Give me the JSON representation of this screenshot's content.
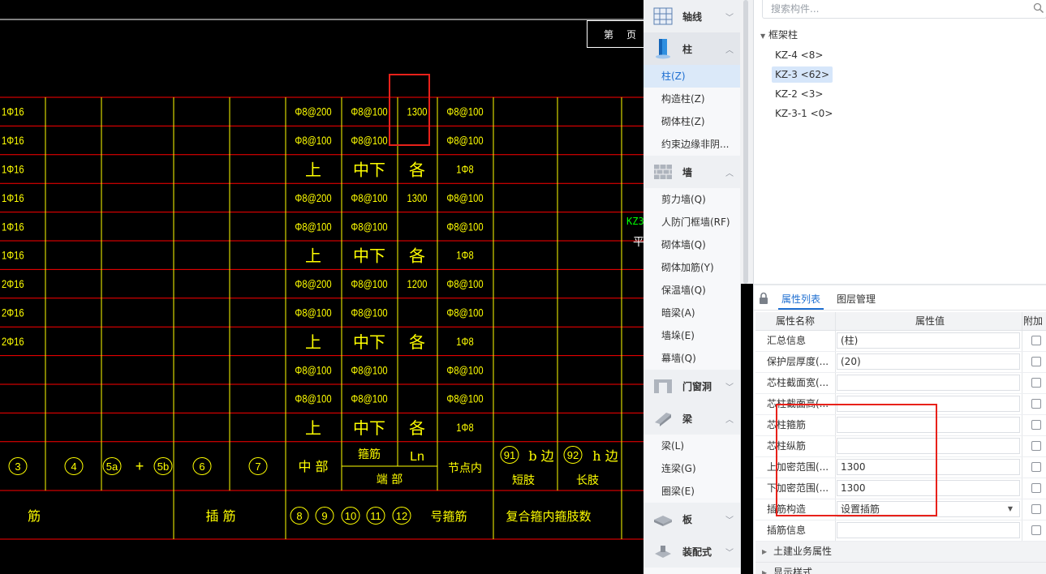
{
  "cad": {
    "title_cells": [
      "第",
      "页"
    ],
    "note_line1": "KZ3",
    "note_line2": "平",
    "rows": [
      [
        "1Φ16",
        "Φ8@200",
        "Φ8@100",
        "1300",
        "Φ8@100"
      ],
      [
        "1Φ16",
        "Φ8@100",
        "Φ8@100",
        "",
        "Φ8@100"
      ],
      [
        "1Φ16",
        "上",
        "中下",
        "各",
        "1Φ8"
      ],
      [
        "1Φ16",
        "Φ8@200",
        "Φ8@100",
        "1300",
        "Φ8@100"
      ],
      [
        "1Φ16",
        "Φ8@100",
        "Φ8@100",
        "",
        "Φ8@100"
      ],
      [
        "1Φ16",
        "上",
        "中下",
        "各",
        "1Φ8"
      ],
      [
        "2Φ16",
        "Φ8@200",
        "Φ8@100",
        "1200",
        "Φ8@100"
      ],
      [
        "2Φ16",
        "Φ8@100",
        "Φ8@100",
        "",
        "Φ8@100"
      ],
      [
        "2Φ16",
        "上",
        "中下",
        "各",
        "1Φ8"
      ],
      [
        "",
        "Φ8@100",
        "Φ8@100",
        "",
        "Φ8@100"
      ],
      [
        "",
        "Φ8@100",
        "Φ8@100",
        "",
        "Φ8@100"
      ],
      [
        "",
        "上",
        "中下",
        "各",
        "1Φ8"
      ]
    ],
    "header": {
      "circles": [
        "3",
        "4",
        "5a",
        "5b",
        "6",
        "7"
      ],
      "plus": "+",
      "mid": "中 部",
      "gujin": "箍筋",
      "ln": "Ln",
      "duanbu": "端 部",
      "jiedian": "节点内",
      "c91": "91",
      "b_bian": "b 边",
      "duanzhi": "短肢",
      "c92": "92",
      "h_bian": "h 边",
      "changzhi": "长肢",
      "jin": "筋",
      "chajin": "插 筋",
      "circles2": [
        "8",
        "9",
        "10",
        "11",
        "12"
      ],
      "hao_gujin": "号箍筋",
      "fuhe": "复合箍内箍肢数"
    }
  },
  "categories": [
    {
      "label": "轴线",
      "icon": "grid-icon",
      "expanded": false,
      "items": []
    },
    {
      "label": "柱",
      "icon": "column-icon",
      "expanded": true,
      "selected": true,
      "items": [
        "柱(Z)",
        "构造柱(Z)",
        "砌体柱(Z)",
        "约束边缘非阴..."
      ]
    },
    {
      "label": "墙",
      "icon": "wall-icon",
      "expanded": true,
      "items": [
        "剪力墙(Q)",
        "人防门框墙(RF)",
        "砌体墙(Q)",
        "砌体加筋(Y)",
        "保温墙(Q)",
        "暗梁(A)",
        "墙垛(E)",
        "幕墙(Q)"
      ]
    },
    {
      "label": "门窗洞",
      "icon": "door-window-icon",
      "expanded": false,
      "items": []
    },
    {
      "label": "梁",
      "icon": "beam-icon",
      "expanded": true,
      "items": [
        "梁(L)",
        "连梁(G)",
        "圈梁(E)"
      ]
    },
    {
      "label": "板",
      "icon": "slab-icon",
      "expanded": false,
      "items": []
    },
    {
      "label": "装配式",
      "icon": "prefab-icon",
      "expanded": false,
      "items": []
    }
  ],
  "search": {
    "placeholder": "搜索构件..."
  },
  "tree": {
    "root": "框架柱",
    "items": [
      "KZ-4 <8>",
      "KZ-3 <62>",
      "KZ-2 <3>",
      "KZ-3-1 <0>"
    ],
    "selected_index": 1
  },
  "tabs": [
    "属性列表",
    "图层管理"
  ],
  "properties": {
    "headers": [
      "属性名称",
      "属性值",
      "附加"
    ],
    "rows": [
      {
        "name": "汇总信息",
        "value": "(柱)"
      },
      {
        "name": "保护层厚度(...",
        "value": "(20)"
      },
      {
        "name": "芯柱截面宽(...",
        "value": ""
      },
      {
        "name": "芯柱截面高(...",
        "value": ""
      },
      {
        "name": "芯柱箍筋",
        "value": ""
      },
      {
        "name": "芯柱纵筋",
        "value": ""
      },
      {
        "name": "上加密范围(...",
        "value": "1300"
      },
      {
        "name": "下加密范围(...",
        "value": "1300"
      },
      {
        "name": "插筋构造",
        "value": "设置插筋",
        "dropdown": true
      },
      {
        "name": "插筋信息",
        "value": ""
      }
    ],
    "groups": [
      "土建业务属性",
      "显示样式"
    ]
  },
  "colors": {
    "cad_text": "#ffff00",
    "cad_grid": "#ff0000",
    "highlight": "#e8211a",
    "accent": "#1f6fd1"
  }
}
